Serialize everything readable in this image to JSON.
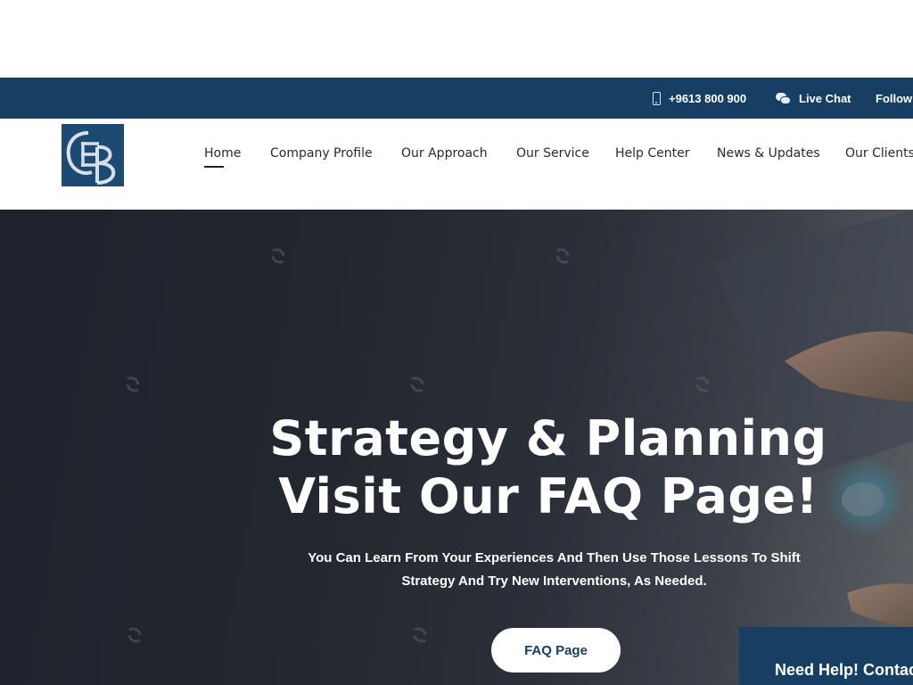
{
  "topbar": {
    "phone_icon": "mobile-phone-icon",
    "phone": "+9613 800 900",
    "chat_icon": "chat-bubbles-icon",
    "live_chat": "Live Chat",
    "follow": "Follow"
  },
  "nav": {
    "items": [
      "Home",
      "Company Profile",
      "Our Approach",
      "Our Service",
      "Help Center",
      "News & Updates",
      "Our Clients"
    ],
    "active": "Home"
  },
  "hero": {
    "title_line1": "Strategy & Planning",
    "title_line2": "Visit Our FAQ Page!",
    "subtitle_line1": "You Can Learn From Your Experiences And Then Use Those Lessons To Shift",
    "subtitle_line2": "Strategy And Try New Interventions, As Needed.",
    "cta": "FAQ Page",
    "help": "Need Help! Contact"
  },
  "colors": {
    "brand_navy": "#163f63",
    "hero_dark": "#1d222c",
    "white": "#ffffff"
  }
}
